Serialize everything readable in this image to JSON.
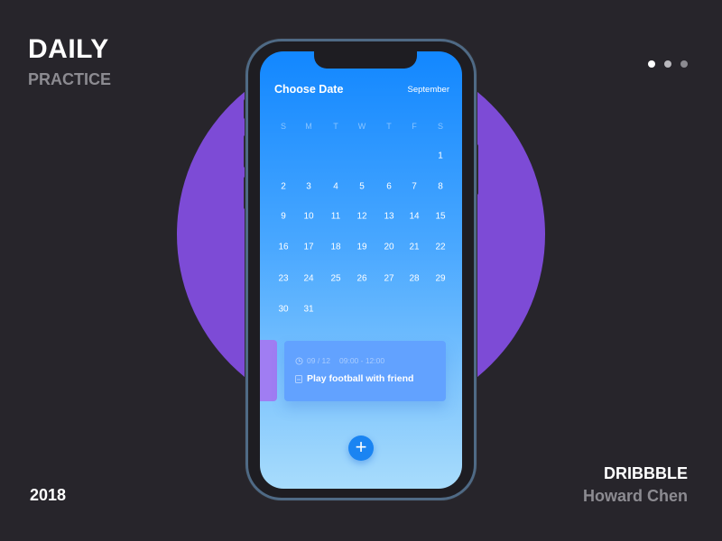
{
  "left": {
    "title": "DAILY",
    "subtitle": "PRACTICE",
    "year": "2018"
  },
  "right": {
    "brand": "DRIBBBLE",
    "author": "Howard Chen"
  },
  "pager": {
    "count": 3,
    "active": 0
  },
  "colors": {
    "background": "#27252b",
    "circle": "#7d4bd6",
    "accent": "#1a84f2"
  },
  "app": {
    "header": {
      "title": "Choose Date",
      "month": "September"
    },
    "weekdays": [
      "S",
      "M",
      "T",
      "W",
      "T",
      "F",
      "S"
    ],
    "weeks": [
      [
        "",
        "",
        "",
        "",
        "",
        "",
        "1"
      ],
      [
        "2",
        "3",
        "4",
        "5",
        "6",
        "7",
        "8"
      ],
      [
        "9",
        "10",
        "11",
        "12",
        "13",
        "14",
        "15"
      ],
      [
        "16",
        "17",
        "18",
        "19",
        "20",
        "21",
        "22"
      ],
      [
        "23",
        "24",
        "25",
        "26",
        "27",
        "28",
        "29"
      ],
      [
        "30",
        "31",
        "",
        "",
        "",
        "",
        ""
      ]
    ],
    "event": {
      "date": "09 / 12",
      "time": "09:00 - 12:00",
      "title": "Play football with friend",
      "clock_icon": "clock-icon",
      "task_icon": "note-icon"
    },
    "add_button": {
      "icon": "plus-icon",
      "label": "+"
    }
  }
}
